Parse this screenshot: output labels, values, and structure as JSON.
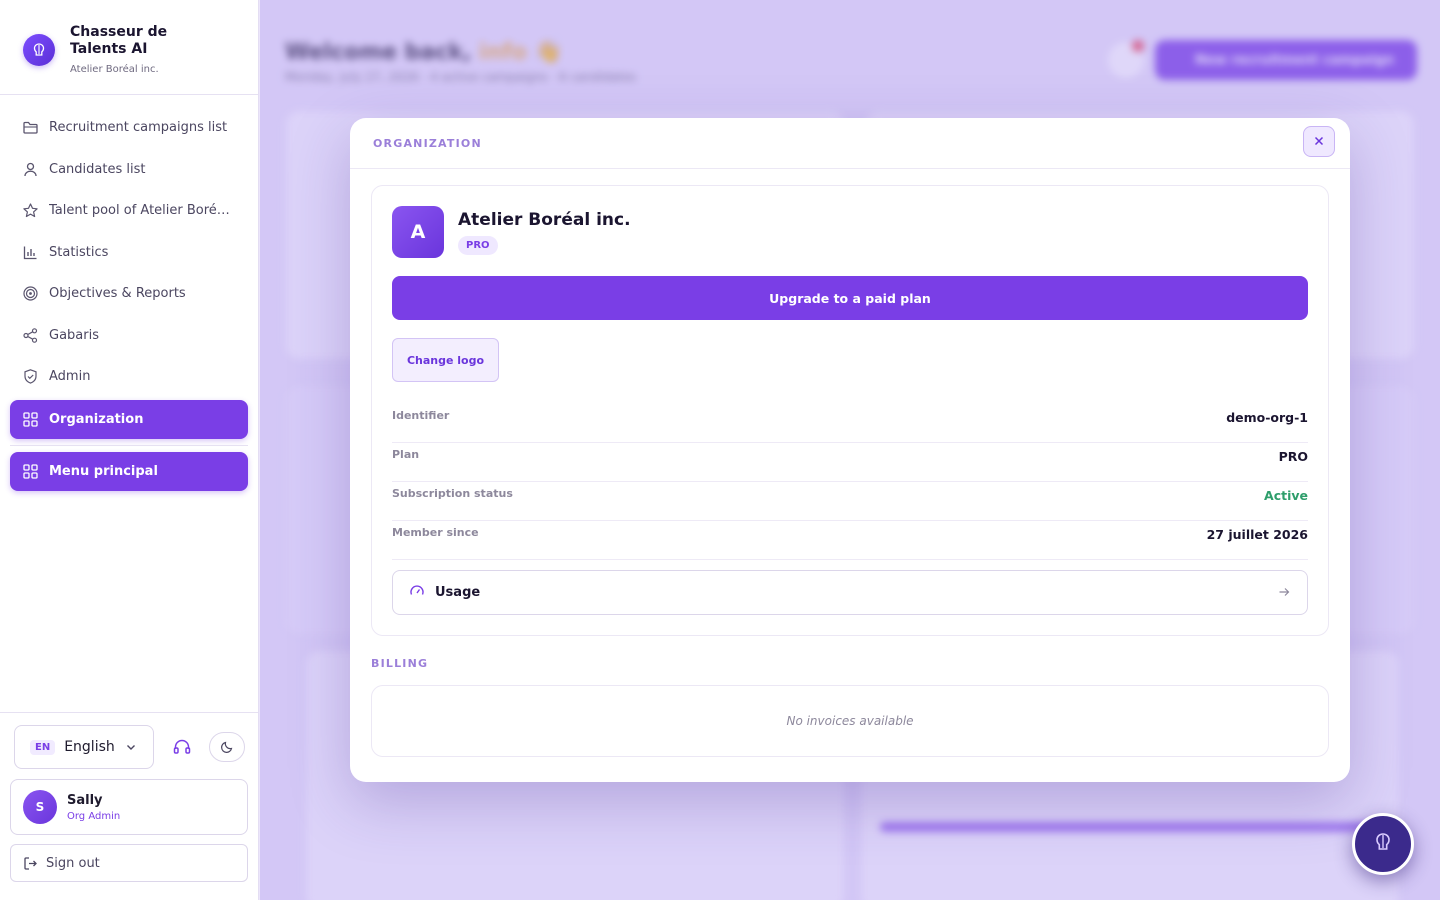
{
  "app": {
    "name": "Chasseur de Talents AI",
    "org": "Atelier Boréal inc."
  },
  "sidebar": {
    "items": [
      {
        "label": "Recruitment campaigns list",
        "icon": "folder-icon"
      },
      {
        "label": "Candidates list",
        "icon": "user-icon"
      },
      {
        "label": "Talent pool of Atelier Boréal inc.",
        "icon": "star-icon"
      },
      {
        "label": "Statistics",
        "icon": "bar-chart-icon"
      },
      {
        "label": "Objectives & Reports",
        "icon": "target-icon"
      },
      {
        "label": "Gabaris",
        "icon": "share-icon"
      },
      {
        "label": "Admin",
        "icon": "shield-icon"
      }
    ],
    "active_items": [
      {
        "label": "Organization",
        "icon": "grid-icon"
      },
      {
        "label": "Menu principal",
        "icon": "grid-icon"
      }
    ],
    "language": {
      "code": "EN",
      "name": "English"
    },
    "user": {
      "initial": "S",
      "name": "Sally",
      "role": "Org Admin"
    },
    "signout_label": "Sign out"
  },
  "background": {
    "welcome": "Welcome back,",
    "welcome_name": "info",
    "welcome_emoji": "👋",
    "subtitle": "Monday, July 27, 2026 · 4 active campaigns · 6 candidates",
    "new_campaign_label": "New recruitment campaign"
  },
  "modal": {
    "section_title": "ORGANIZATION",
    "org_initial": "A",
    "org_name": "Atelier Boréal inc.",
    "plan_badge": "PRO",
    "upgrade_label": "Upgrade to a paid plan",
    "change_logo_label": "Change logo",
    "rows": [
      {
        "label": "Identifier",
        "value": "demo-org-1"
      },
      {
        "label": "Plan",
        "value": "PRO"
      },
      {
        "label": "Subscription status",
        "value": "Active"
      },
      {
        "label": "Member since",
        "value": "27 juillet 2026"
      }
    ],
    "usage_label": "Usage",
    "billing_title": "BILLING",
    "billing_empty": "No invoices available"
  },
  "colors": {
    "accent": "#7a3ee6",
    "status_active": "#2e9e6b"
  }
}
